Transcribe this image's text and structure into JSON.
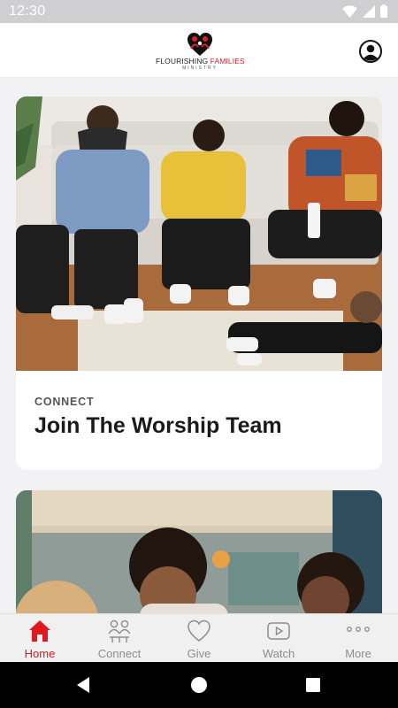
{
  "status_bar": {
    "time": "12:30"
  },
  "header": {
    "logo_word_1": "FLOURISHING",
    "logo_word_2": "FAMILIES",
    "logo_subtitle": "MINISTRY",
    "brand_color": "#d8232a"
  },
  "feed": {
    "cards": [
      {
        "category": "CONNECT",
        "title": "Join The Worship Team",
        "image": "worship-team-photo"
      },
      {
        "category": "",
        "title": "",
        "image": "friends-gathering-photo"
      }
    ]
  },
  "bottom_nav": {
    "active_color": "#e0191f",
    "items": [
      {
        "label": "Home",
        "icon": "home-icon",
        "active": true
      },
      {
        "label": "Connect",
        "icon": "people-icon",
        "active": false
      },
      {
        "label": "Give",
        "icon": "heart-icon",
        "active": false
      },
      {
        "label": "Watch",
        "icon": "play-icon",
        "active": false
      },
      {
        "label": "More",
        "icon": "more-dots-icon",
        "active": false
      }
    ]
  }
}
